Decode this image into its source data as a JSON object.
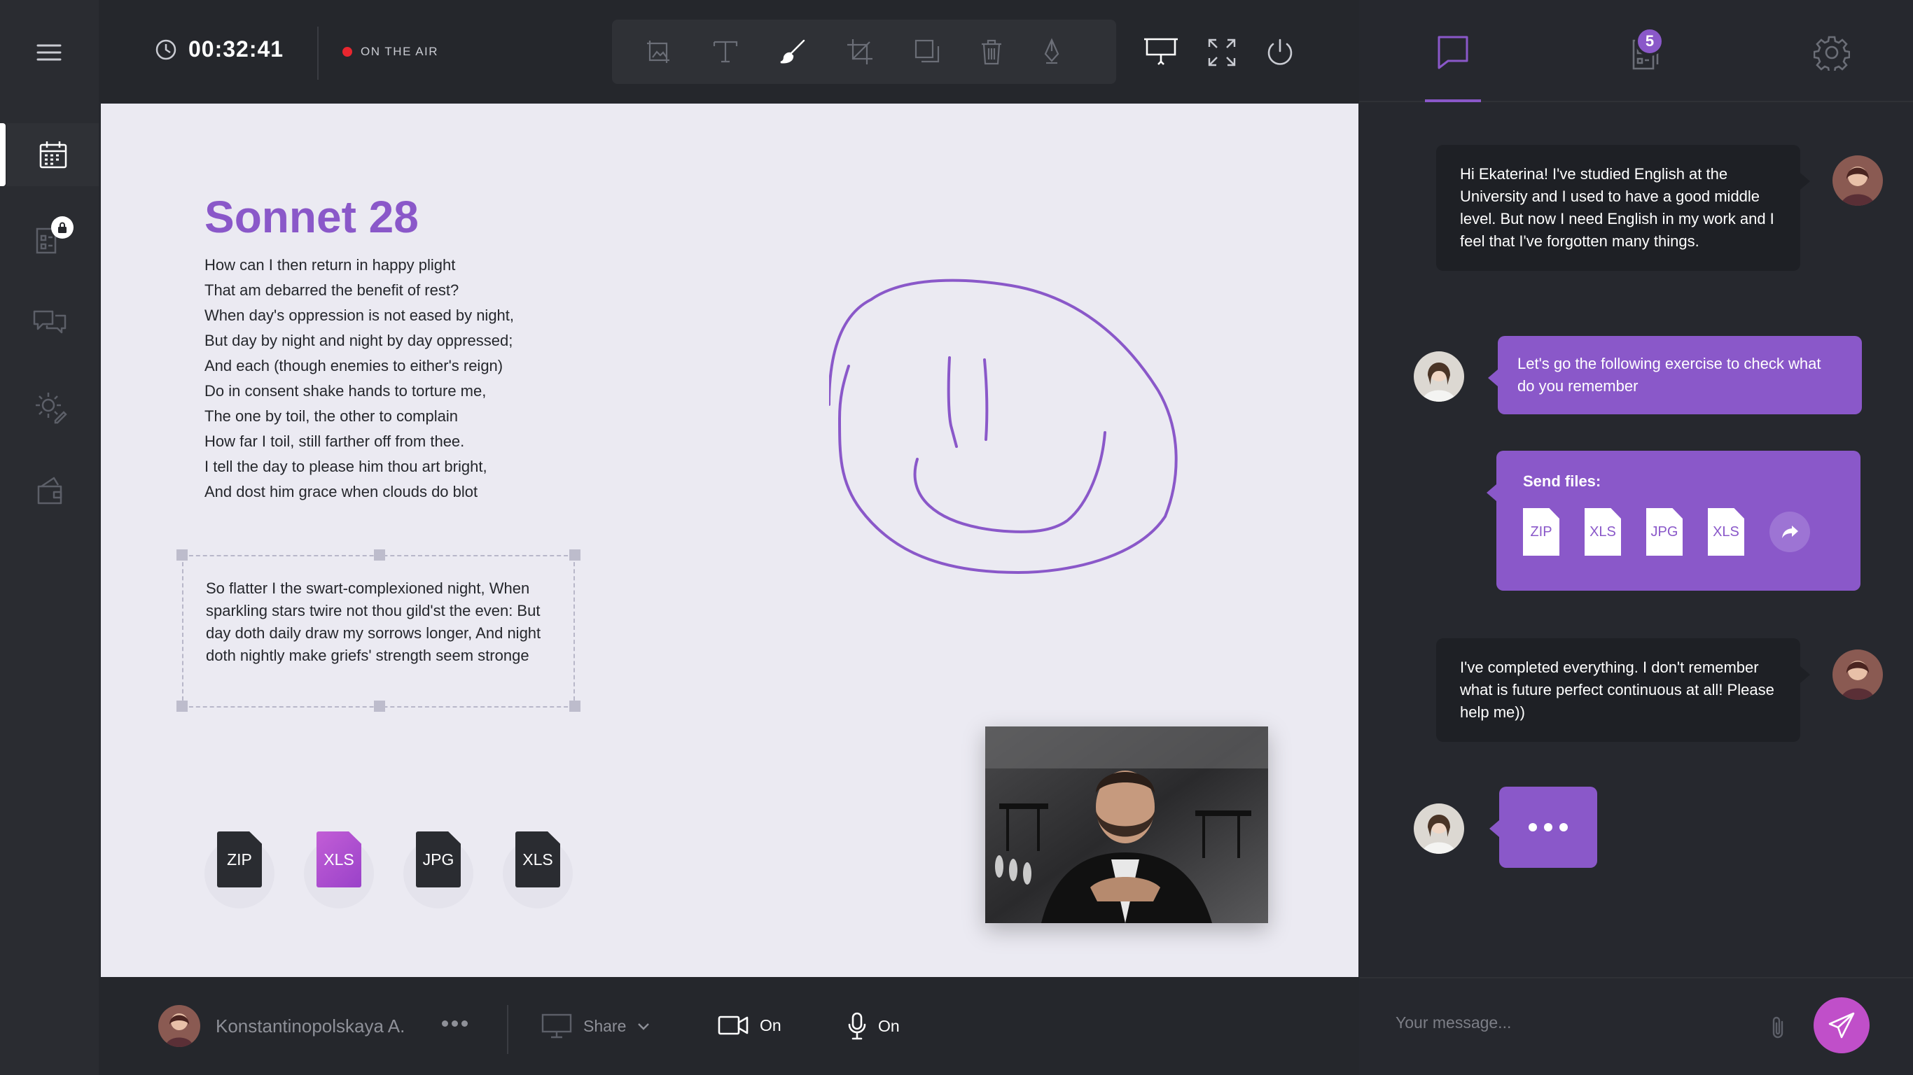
{
  "header": {
    "timer": "00:32:41",
    "on_air": "ON THE AIR"
  },
  "sidebar": {
    "items": [
      {
        "name": "schedule",
        "icon": "calendar-icon"
      },
      {
        "name": "locked-notes",
        "icon": "locked-document-icon",
        "badge_icon": "lock-icon"
      },
      {
        "name": "chats",
        "icon": "chat-bubbles-icon"
      },
      {
        "name": "settings",
        "icon": "gear-pen-icon"
      },
      {
        "name": "wallet",
        "icon": "wallet-icon"
      }
    ]
  },
  "toolbar": {
    "tools": [
      "image-crop-icon",
      "text-icon",
      "brush-icon",
      "crop-icon",
      "copy-icon",
      "trash-icon",
      "pen-icon"
    ],
    "right": [
      "presentation-icon",
      "fullscreen-icon",
      "power-icon"
    ]
  },
  "canvas": {
    "title": "Sonnet 28",
    "poem_lines": [
      "How can I then return in happy plight",
      "That am debarred the benefit of rest?",
      "When day's oppression is not eased by night,",
      "But day by night and night by day oppressed;",
      "And each (though enemies to either's reign)",
      "Do in consent shake hands to torture me,",
      "The one by toil, the other to complain",
      "How far I toil, still farther off from thee.",
      "I tell the day to please him thou art bright,",
      "And dost him grace when clouds do blot"
    ],
    "selected_text": "So flatter I the swart-complexioned night, When sparkling stars twire not thou gild'st the even: But day doth daily draw my sorrows longer, And night doth nightly make griefs' strength seem stronge",
    "files": [
      {
        "label": "ZIP",
        "color": "#2a2c31"
      },
      {
        "label": "XLS",
        "color": "#b04fd0"
      },
      {
        "label": "JPG",
        "color": "#2a2c31"
      },
      {
        "label": "XLS",
        "color": "#2a2c31"
      }
    ]
  },
  "bottombar": {
    "user_name": "Konstantinopolskaya A.",
    "share_label": "Share",
    "camera_label": "On",
    "mic_label": "On"
  },
  "chat": {
    "tab_badge": "5",
    "messages": [
      {
        "from": "student",
        "text": "Hi Ekaterina! I've studied English at the University and I used to have a good middle level. But now I need English in my work and I feel that I've forgotten many things."
      },
      {
        "from": "teacher",
        "text": "Let's go the following exercise to check what do you remember"
      },
      {
        "from": "teacher",
        "files_title": "Send files:",
        "files": [
          "ZIP",
          "XLS",
          "JPG",
          "XLS"
        ]
      },
      {
        "from": "student",
        "text": "I've completed everything. I don't remember what is future perfect continuous at all! Please help me))"
      }
    ],
    "compose_placeholder": "Your message..."
  },
  "colors": {
    "accent": "#8a58c9",
    "send": "#c04fc9",
    "panel": "#26282e",
    "canvas": "#ebeaf2",
    "live": "#e8262f"
  }
}
